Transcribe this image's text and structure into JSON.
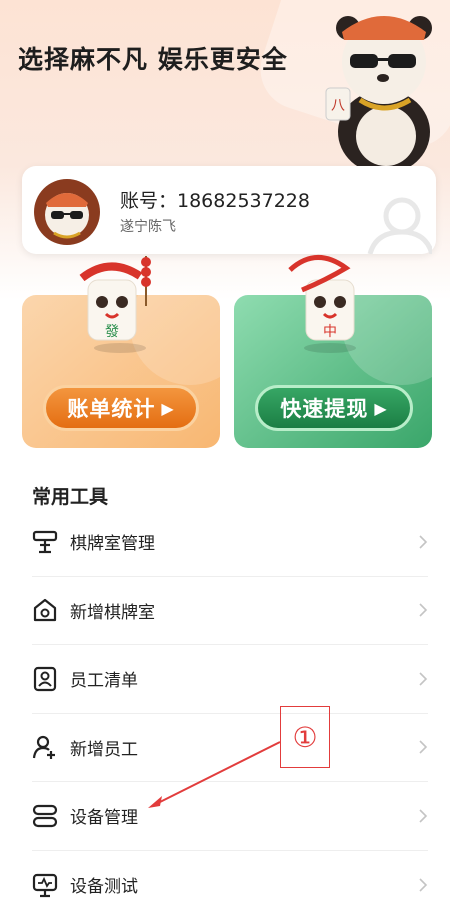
{
  "header": {
    "slogan": "选择麻不凡 娱乐更安全"
  },
  "account": {
    "number_label": "账号：18682537228",
    "name": "遂宁陈飞"
  },
  "promos": [
    {
      "label": "账单统计",
      "tile_glyph": "發",
      "color": "#e46e12"
    },
    {
      "label": "快速提现",
      "tile_glyph": "中",
      "color": "#1b7e44"
    }
  ],
  "tools": {
    "title": "常用工具",
    "items": [
      {
        "label": "棋牌室管理",
        "icon": "mahjong-table-icon"
      },
      {
        "label": "新增棋牌室",
        "icon": "add-room-house-icon"
      },
      {
        "label": "员工清单",
        "icon": "staff-list-icon"
      },
      {
        "label": "新增员工",
        "icon": "add-staff-icon"
      },
      {
        "label": "设备管理",
        "icon": "device-management-icon"
      },
      {
        "label": "设备测试",
        "icon": "device-test-icon"
      }
    ]
  },
  "annotation": {
    "marker": "①",
    "color": "#e23c3c"
  }
}
